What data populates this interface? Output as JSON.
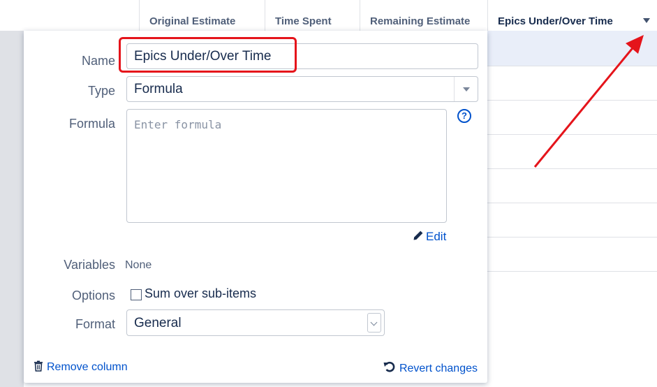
{
  "grid": {
    "columns": [
      {
        "label": "Original Estimate"
      },
      {
        "label": "Time Spent"
      },
      {
        "label": "Remaining Estimate"
      },
      {
        "label": "Epics Under/Over Time"
      }
    ]
  },
  "dialog": {
    "name": {
      "label": "Name",
      "value": "Epics Under/Over Time"
    },
    "type": {
      "label": "Type",
      "value": "Formula"
    },
    "formula": {
      "label": "Formula",
      "placeholder": "Enter formula",
      "help_icon": "question-circle-icon"
    },
    "edit_label": "Edit",
    "variables": {
      "label": "Variables",
      "value": "None"
    },
    "options": {
      "label": "Options",
      "checkbox_label": "Sum over sub-items",
      "checked": false
    },
    "format": {
      "label": "Format",
      "value": "General"
    },
    "remove_label": "Remove column",
    "revert_label": "Revert changes"
  },
  "annotation": {
    "highlight_color": "#e5141b"
  }
}
